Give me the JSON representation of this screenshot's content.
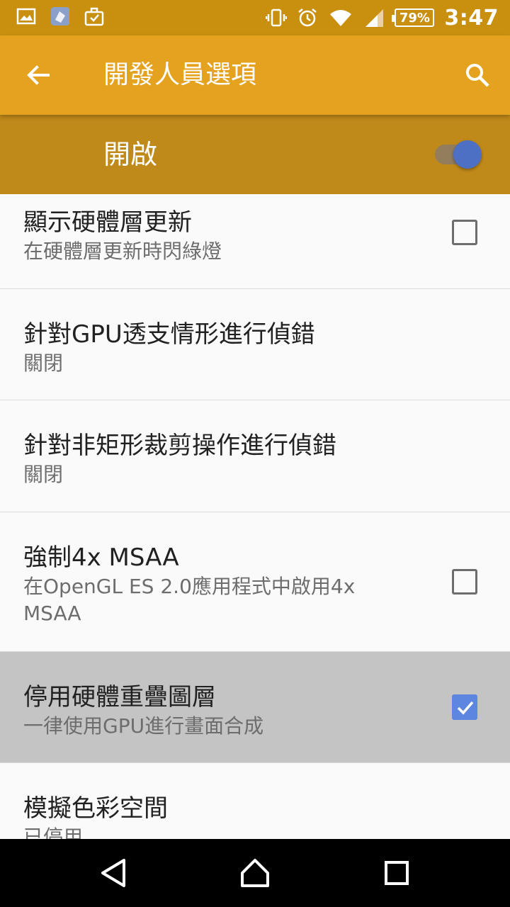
{
  "status_bar": {
    "battery": "79%",
    "time": "3:47"
  },
  "app_bar": {
    "title": "開發人員選項"
  },
  "master_switch": {
    "label": "開啟",
    "on": true
  },
  "colors": {
    "status_bar": "#c9900f",
    "app_bar": "#e4a21f",
    "master_bar": "#c08a1a",
    "accent": "#5c86e0"
  },
  "list": {
    "items": [
      {
        "title": "顯示硬體層更新",
        "subtitle": "在硬體層更新時閃綠燈",
        "control": "checkbox",
        "checked": false
      },
      {
        "title": "針對GPU透支情形進行偵錯",
        "subtitle": "關閉",
        "control": "none"
      },
      {
        "title": "針對非矩形裁剪操作進行偵錯",
        "subtitle": "關閉",
        "control": "none"
      },
      {
        "title": "強制4x MSAA",
        "subtitle_line1": "在OpenGL ES 2.0應用程式中啟用4x",
        "subtitle_line2": "MSAA",
        "control": "checkbox",
        "checked": false
      },
      {
        "title": "停用硬體重疊圖層",
        "subtitle": "一律使用GPU進行畫面合成",
        "control": "checkbox",
        "checked": true
      },
      {
        "title": "模擬色彩空間",
        "subtitle": "已停用",
        "control": "none"
      }
    ]
  },
  "icons": {
    "back": "arrow-back-icon",
    "search": "search-icon",
    "nav_back": "triangle-back-icon",
    "nav_home": "home-icon",
    "nav_recents": "square-recents-icon"
  }
}
